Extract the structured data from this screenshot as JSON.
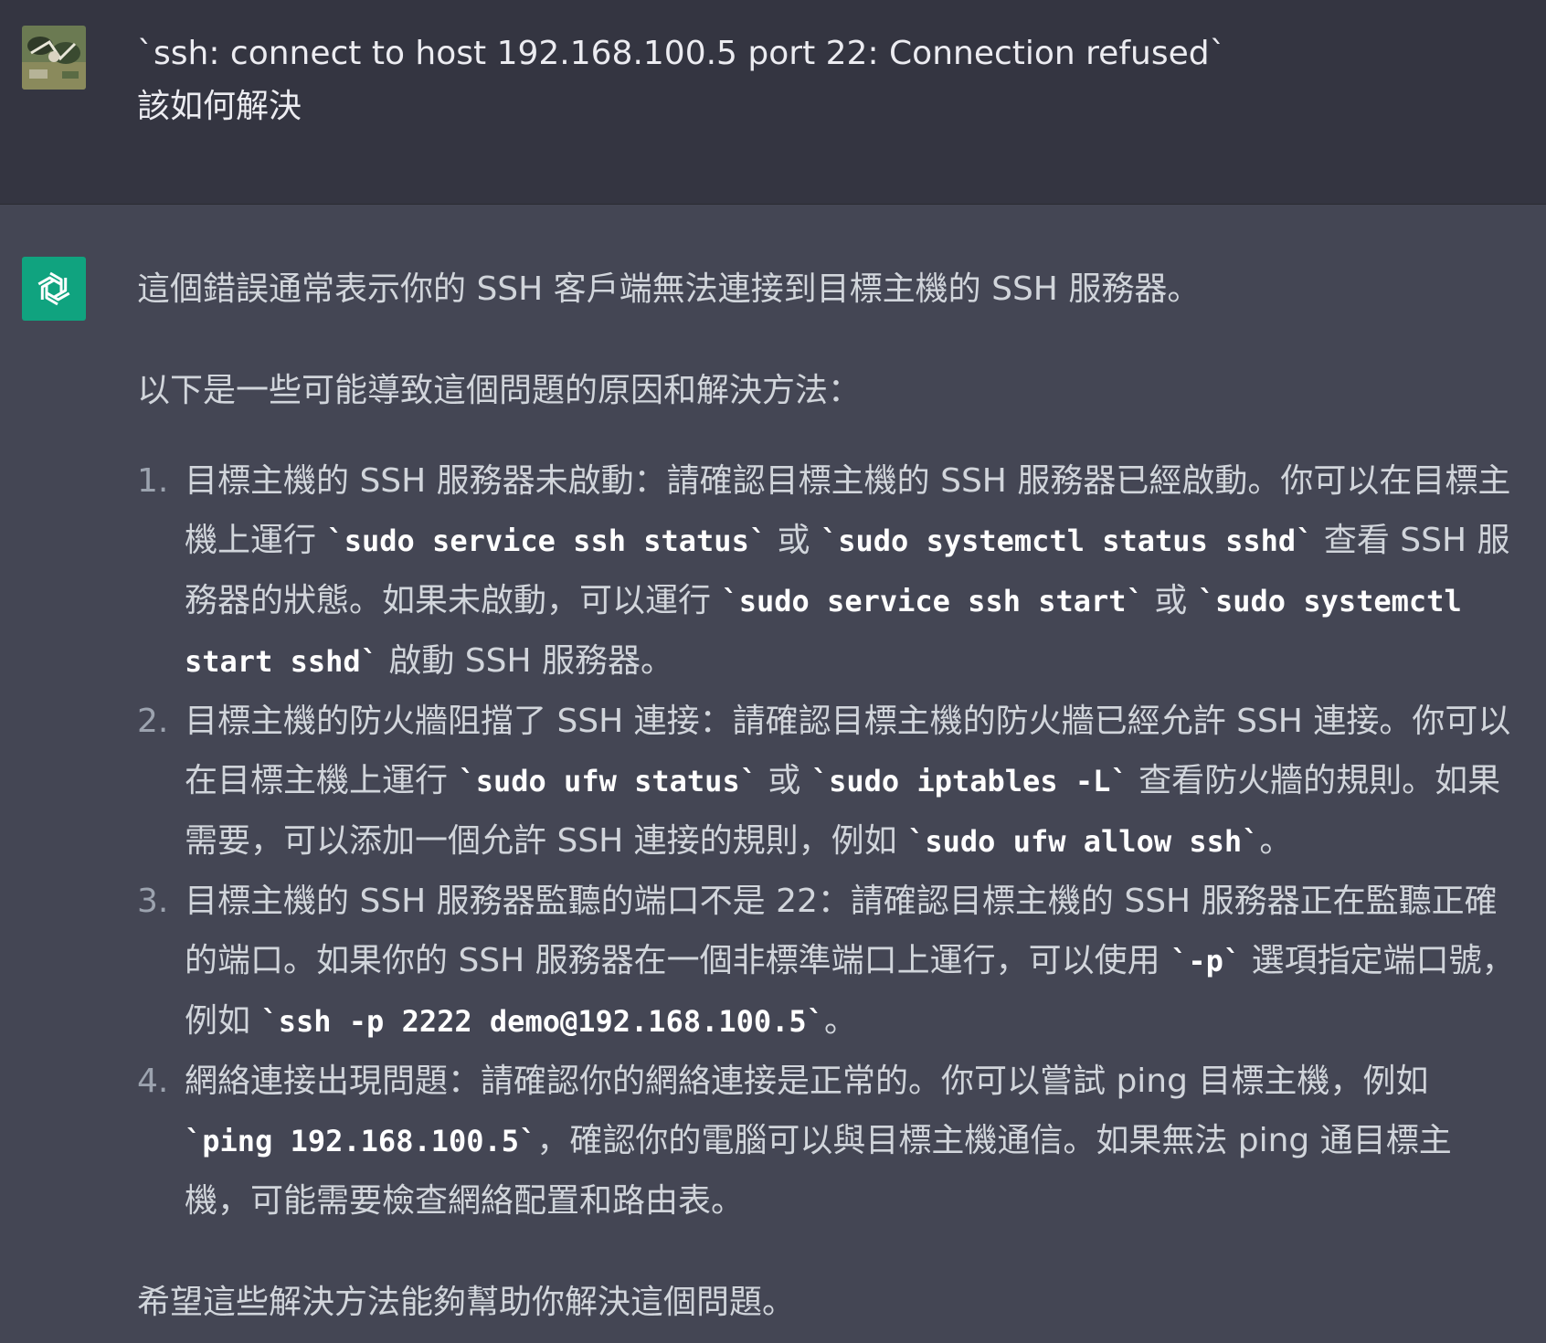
{
  "user": {
    "line1": "`ssh: connect to host 192.168.100.5 port 22: Connection refused`",
    "line2": "該如何解決"
  },
  "assistant": {
    "intro": "這個錯誤通常表示你的 SSH 客戶端無法連接到目標主機的 SSH 服務器。",
    "lead": "以下是一些可能導致這個問題的原因和解決方法：",
    "steps": [
      {
        "num": "1.",
        "t1": "目標主機的 SSH 服務器未啟動：請確認目標主機的 SSH 服務器已經啟動。你可以在目標主機上運行 ",
        "c1": "`sudo service ssh status`",
        "t2": " 或 ",
        "c2": "`sudo systemctl status sshd`",
        "t3": " 查看 SSH 服務器的狀態。如果未啟動，可以運行 ",
        "c3": "`sudo service ssh start`",
        "t4": " 或 ",
        "c4": "`sudo systemctl start sshd`",
        "t5": " 啟動 SSH 服務器。"
      },
      {
        "num": "2.",
        "t1": "目標主機的防火牆阻擋了 SSH 連接：請確認目標主機的防火牆已經允許 SSH 連接。你可以在目標主機上運行 ",
        "c1": "`sudo ufw status`",
        "t2": " 或 ",
        "c2": "`sudo iptables -L`",
        "t3": " 查看防火牆的規則。如果需要，可以添加一個允許 SSH 連接的規則，例如 ",
        "c3": "`sudo ufw allow ssh`",
        "t4": "。"
      },
      {
        "num": "3.",
        "t1": "目標主機的 SSH 服務器監聽的端口不是 22：請確認目標主機的 SSH 服務器正在監聽正確的端口。如果你的 SSH 服務器在一個非標準端口上運行，可以使用 ",
        "c1": "`-p`",
        "t2": " 選項指定端口號，例如 ",
        "c2": "`ssh -p 2222 demo@192.168.100.5`",
        "t3": "。"
      },
      {
        "num": "4.",
        "t1": "網絡連接出現問題：請確認你的網絡連接是正常的。你可以嘗試 ping 目標主機，例如 ",
        "c1": "`ping 192.168.100.5`",
        "t2": "，確認你的電腦可以與目標主機通信。如果無法 ping 通目標主機，可能需要檢查網絡配置和路由表。"
      }
    ],
    "closing": "希望這些解決方法能夠幫助你解決這個問題。"
  },
  "icons": {
    "user_avatar": "user-avatar-icon",
    "bot_avatar": "openai-logo-icon"
  },
  "colors": {
    "user_bg": "#343541",
    "assistant_bg": "#444654",
    "bot_avatar_bg": "#10a37f"
  }
}
